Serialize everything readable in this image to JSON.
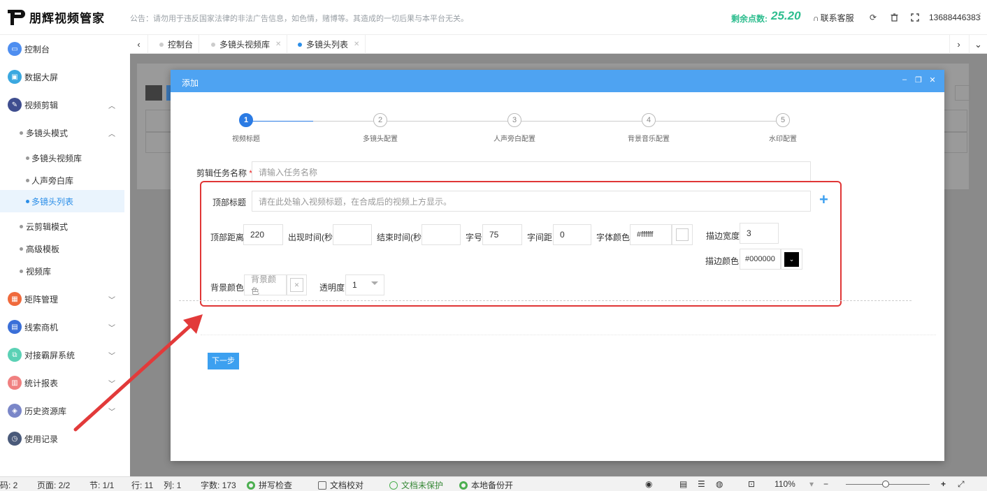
{
  "header": {
    "app_name": "朋辉视频管家",
    "notice": "公告：请勿用于违反国家法律的非法广告信息，如色情，赌博等。其造成的一切后果与本平台无关。",
    "points_label": "剩余点数:",
    "points_value": "25.20",
    "support_label": "联系客服",
    "phone": "13688446383",
    "accent_color": "#2dbd8e"
  },
  "sidebar": {
    "items": [
      {
        "label": "控制台",
        "icon": "monitor-icon",
        "color": "#4e8ef0"
      },
      {
        "label": "数据大屏",
        "icon": "screen-icon",
        "color": "#3aa8e0"
      },
      {
        "label": "视频剪辑",
        "icon": "edit-icon",
        "color": "#3f4e8f"
      },
      {
        "label": "多镜头模式"
      },
      {
        "label": "多镜头视频库"
      },
      {
        "label": "人声旁白库"
      },
      {
        "label": "多镜头列表"
      },
      {
        "label": "云剪辑模式"
      },
      {
        "label": "高级模板"
      },
      {
        "label": "视频库"
      },
      {
        "label": "矩阵管理",
        "icon": "grid-icon",
        "color": "#f06a3c"
      },
      {
        "label": "线索商机",
        "icon": "chart-icon",
        "color": "#3a6fd8"
      },
      {
        "label": "对接霸屏系统",
        "icon": "link-icon",
        "color": "#5bd1b5"
      },
      {
        "label": "统计报表",
        "icon": "bar-icon",
        "color": "#f08080"
      },
      {
        "label": "历史资源库",
        "icon": "layers-icon",
        "color": "#7a86c8"
      },
      {
        "label": "使用记录",
        "icon": "clock-icon",
        "color": "#4a5a7a"
      }
    ]
  },
  "tabs": [
    {
      "label": "控制台"
    },
    {
      "label": "多镜头视频库"
    },
    {
      "label": "多镜头列表"
    }
  ],
  "modal": {
    "title": "添加",
    "steps": [
      {
        "num": "1",
        "label": "视频标题"
      },
      {
        "num": "2",
        "label": "多镜头配置"
      },
      {
        "num": "3",
        "label": "人声旁白配置"
      },
      {
        "num": "4",
        "label": "背景音乐配置"
      },
      {
        "num": "5",
        "label": "水印配置"
      }
    ],
    "task_name_label": "剪辑任务名称",
    "task_name_placeholder": "请输入任务名称",
    "top_title_label": "顶部标题",
    "top_title_placeholder": "请在此处输入视频标题，在合成后的视频上方显示。",
    "fields": {
      "top_distance_label": "顶部距离",
      "top_distance_value": "220",
      "appear_time_label": "出现时间(秒)",
      "appear_time_value": "",
      "end_time_label": "结束时间(秒)",
      "end_time_value": "",
      "font_size_label": "字号",
      "font_size_value": "75",
      "letter_spacing_label": "字间距",
      "letter_spacing_value": "0",
      "font_color_label": "字体颜色",
      "font_color_value": "#ffffff",
      "stroke_width_label": "描边宽度",
      "stroke_width_value": "3",
      "stroke_color_label": "描边颜色",
      "stroke_color_value": "#000000",
      "bg_color_label": "背景颜色",
      "bg_color_placeholder": "背景颜色",
      "opacity_label": "透明度",
      "opacity_value": "1"
    },
    "next_label": "下一步"
  },
  "statusbar": {
    "page_code": "码: 2",
    "page": "页面: 2/2",
    "section": "节: 1/1",
    "row": "行: 11",
    "col": "列: 1",
    "chars": "字数: 173",
    "spell": "拼写检查",
    "proofread": "文档校对",
    "protect": "文档未保护",
    "backup": "本地备份开",
    "zoom": "110%"
  }
}
